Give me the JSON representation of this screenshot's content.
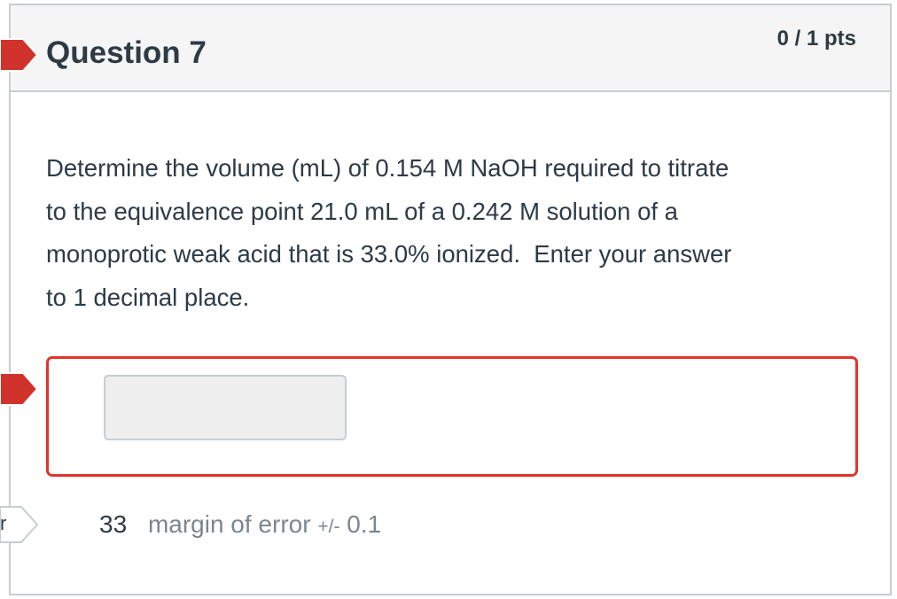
{
  "question": {
    "title": "Question 7",
    "points": "0 / 1 pts",
    "text": "Determine the volume (mL) of 0.154 M NaOH required to titrate\nto the equivalence point 21.0 mL of a 0.242 M solution of a\nmonoprotic weak acid that is 33.0% ionized.  Enter your answer\nto 1 decimal place."
  },
  "answer": {
    "value": "",
    "status": "incorrect"
  },
  "correct_answer": {
    "flag_text": "r",
    "value": "33",
    "margin_label": "margin of error",
    "margin_symbol": "+/-",
    "margin_value": "0.1"
  },
  "colors": {
    "incorrect_flag": "#d0332c",
    "incorrect_border": "#e0352b",
    "correct_flag_border": "#c7cdd1",
    "header_bg": "#f5f5f5",
    "text": "#2d3b45"
  }
}
